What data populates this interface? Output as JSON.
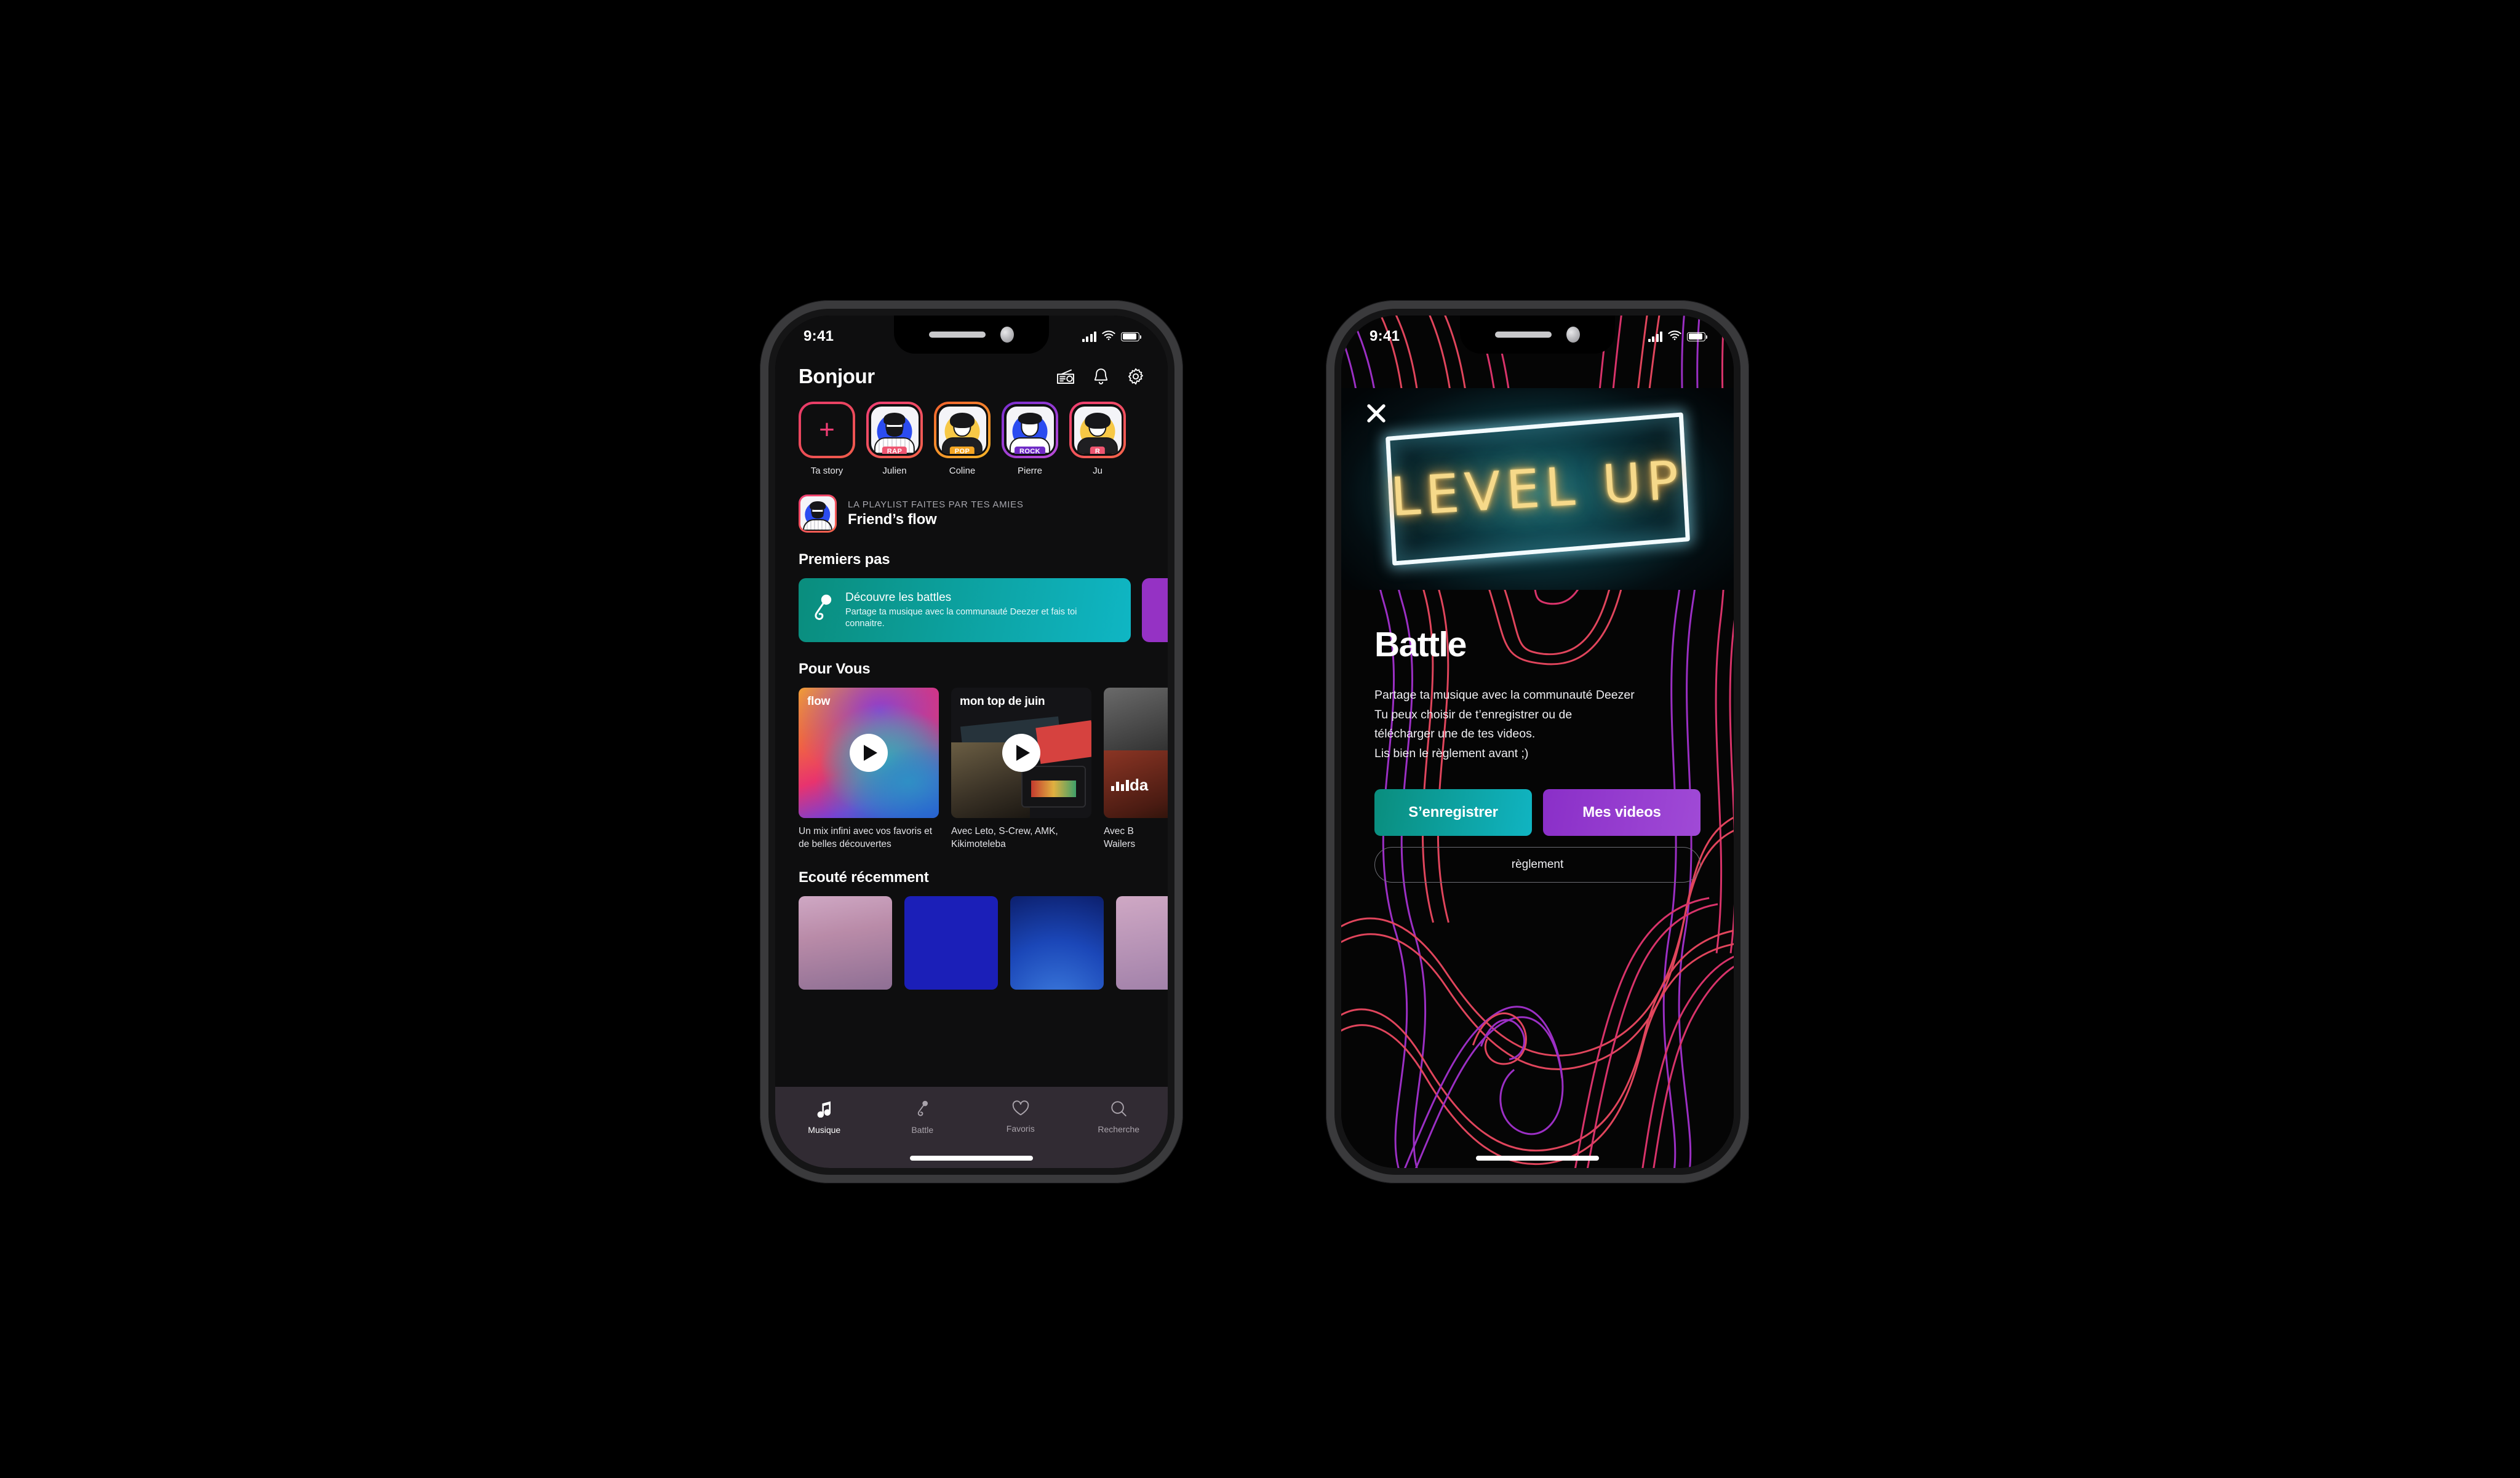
{
  "statusbar": {
    "time": "9:41"
  },
  "home": {
    "header": {
      "title": "Bonjour",
      "icons": [
        {
          "name": "radio-icon"
        },
        {
          "name": "bell-icon"
        },
        {
          "name": "gear-icon"
        }
      ]
    },
    "stories": [
      {
        "name": "Ta story",
        "badge": "",
        "kind": "add"
      },
      {
        "name": "Julien",
        "badge": "RAP",
        "kind": "rap"
      },
      {
        "name": "Coline",
        "badge": "POP",
        "kind": "pop"
      },
      {
        "name": "Pierre",
        "badge": "ROCK",
        "kind": "rock"
      },
      {
        "name": "Ju",
        "badge": "R",
        "kind": "rap"
      }
    ],
    "playlist_row": {
      "kicker": "LA PLAYLIST FAITES PAR TES AMIES",
      "title": "Friend’s flow"
    },
    "first_steps": {
      "section_title": "Premiers pas",
      "tile_title": "Découvre les battles",
      "tile_subtitle": "Partage ta musique avec la communauté Deezer et fais toi connaitre."
    },
    "for_you": {
      "section_title": "Pour Vous",
      "cards": [
        {
          "label": "flow",
          "desc": "Un mix infini avec vos favoris et de belles découvertes"
        },
        {
          "label": "mon top de juin",
          "desc": "Avec Leto, S-Crew, AMK, Kikimoteleba"
        },
        {
          "label": "da",
          "desc": "Avec B\nWailers"
        }
      ]
    },
    "recent": {
      "section_title": "Ecouté récemment"
    },
    "tabbar": [
      {
        "label": "Musique",
        "icon": "music-note-icon",
        "active": true
      },
      {
        "label": "Battle",
        "icon": "microphone-icon",
        "active": false
      },
      {
        "label": "Favoris",
        "icon": "heart-icon",
        "active": false
      },
      {
        "label": "Recherche",
        "icon": "search-icon",
        "active": false
      }
    ]
  },
  "battle": {
    "close_label": "✕",
    "hero_neon_text": "LEVEL UP",
    "title": "Battle",
    "description": "Partage ta musique avec la communauté Deezer\nTu peux choisir de t’enregistrer ou de\ntélécharger une de tes videos.\nLis bien le règlement avant ;)",
    "primary_button": "S’enregistrer",
    "secondary_button": "Mes videos",
    "rules_button": "règlement"
  },
  "colors": {
    "teal": "#0fb6c4",
    "purple": "#9532c4",
    "pink": "#ef3d74",
    "orange": "#f5a623",
    "rock_purple": "#6f2bc6",
    "background": "#000000",
    "tabbar": "#312b33"
  }
}
